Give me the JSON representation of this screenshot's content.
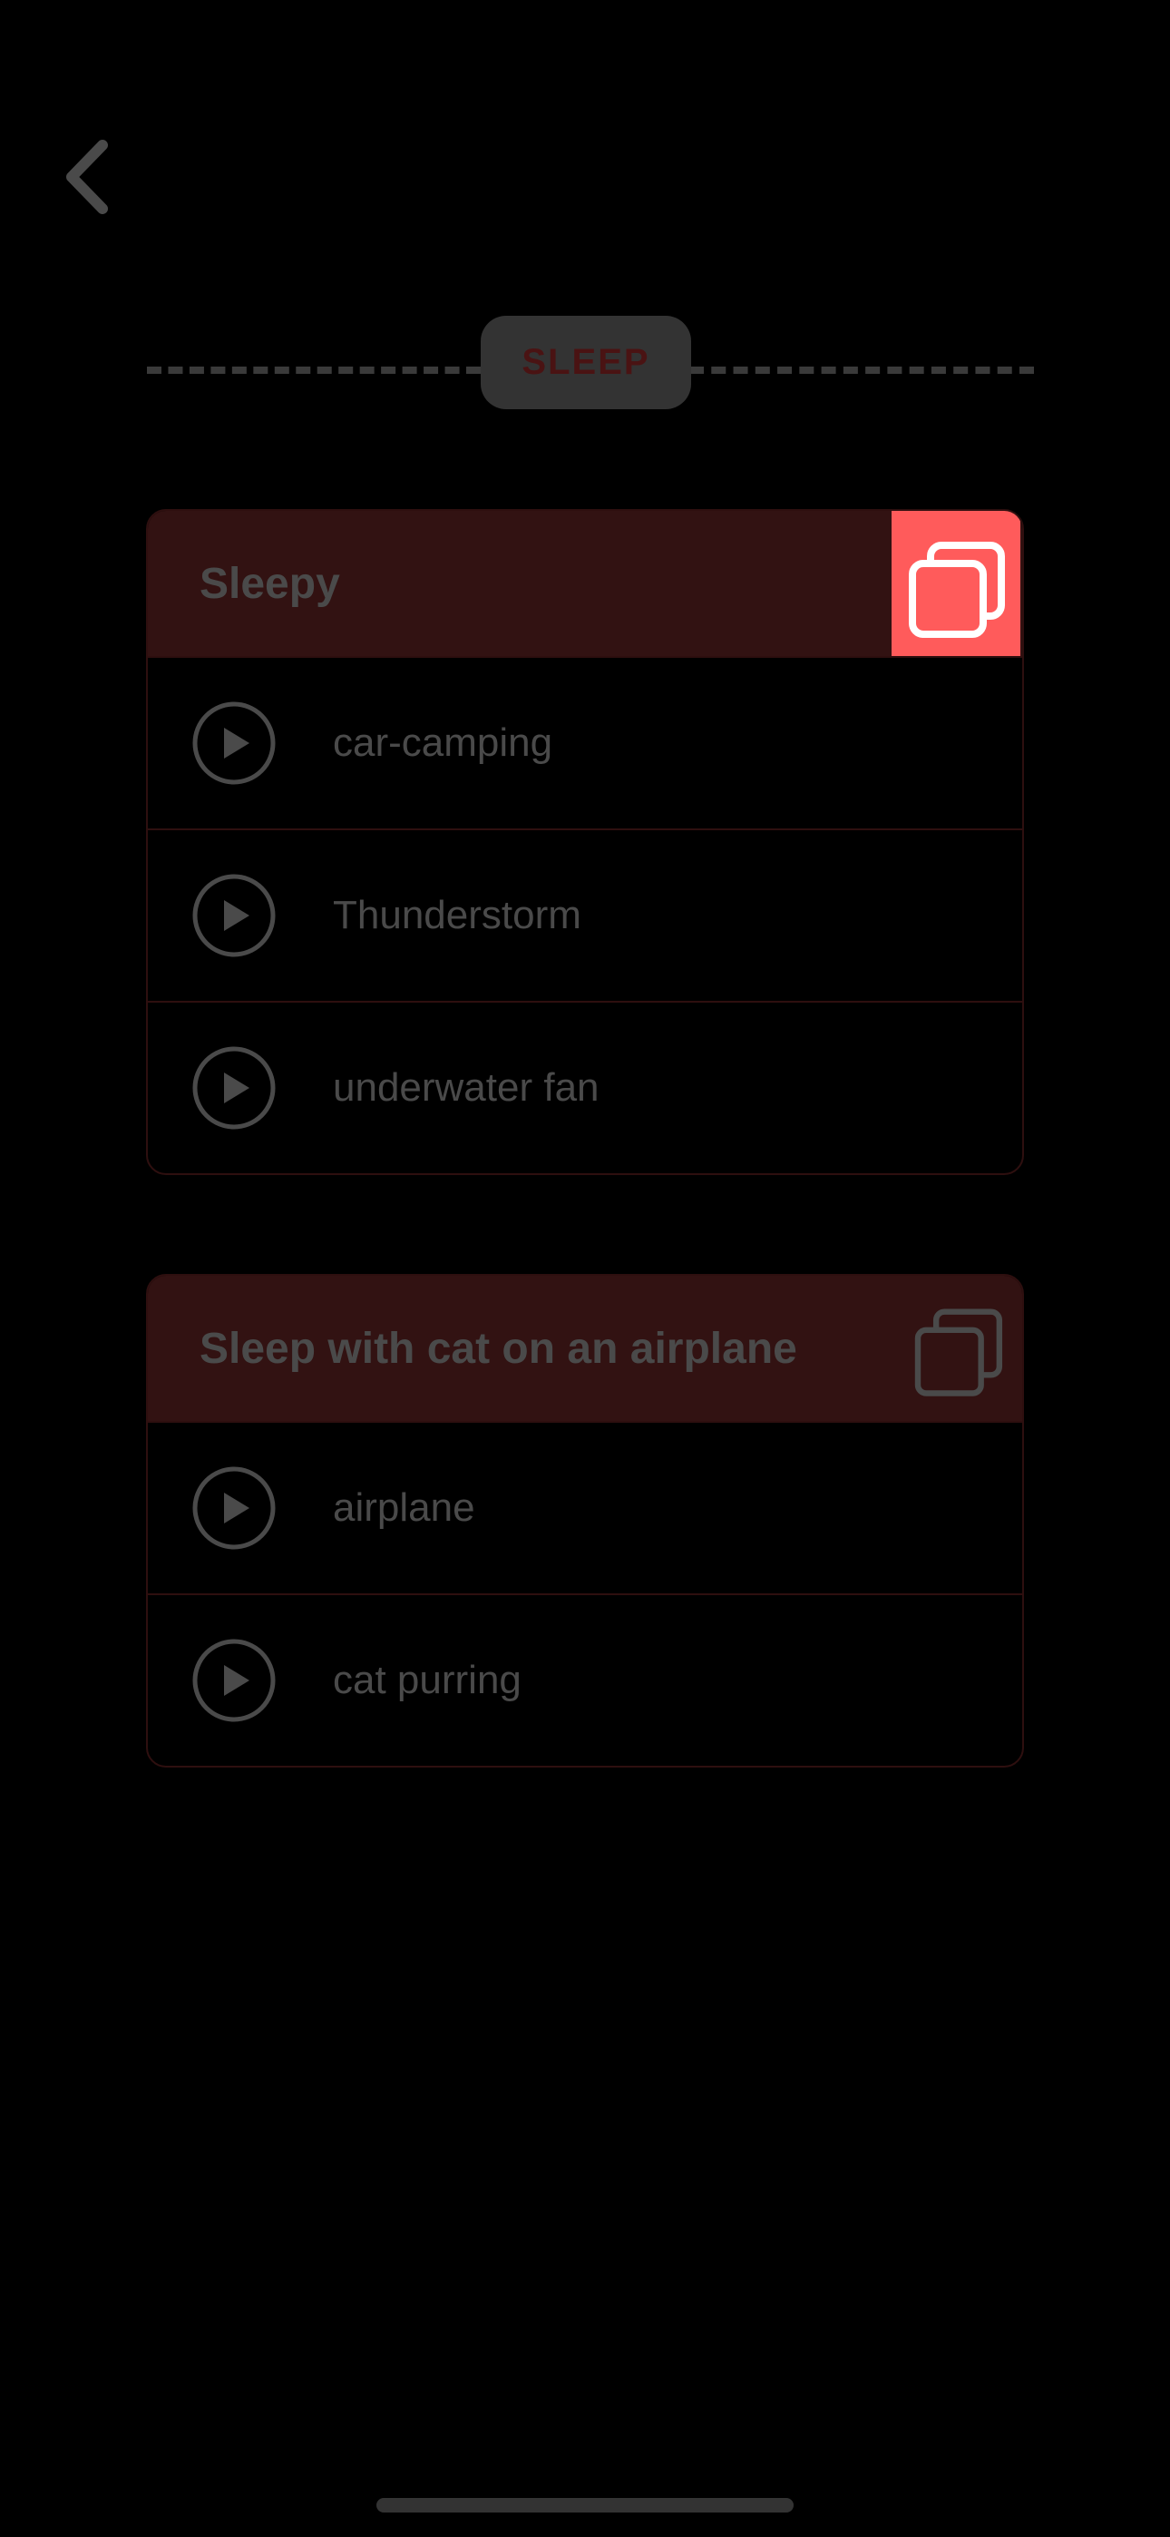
{
  "nav": {
    "back_icon": "chevron-left-icon"
  },
  "section": {
    "label": "SLEEP"
  },
  "mixes": [
    {
      "title": "Sleepy",
      "copy_icon": "copy-icon",
      "sounds": [
        {
          "label": "car-camping"
        },
        {
          "label": "Thunderstorm"
        },
        {
          "label": "underwater fan"
        }
      ]
    },
    {
      "title": "Sleep with cat on an airplane",
      "copy_icon": "copy-icon",
      "sounds": [
        {
          "label": "airplane"
        },
        {
          "label": "cat purring"
        }
      ]
    }
  ],
  "colors": {
    "background": "#000000",
    "card_header": "#321212",
    "card_border": "#2e0f0f",
    "highlight": "#ff5b5b",
    "pill_bg": "#333333",
    "pill_text": "#4a1313",
    "muted_text": "#4a4a4a"
  }
}
